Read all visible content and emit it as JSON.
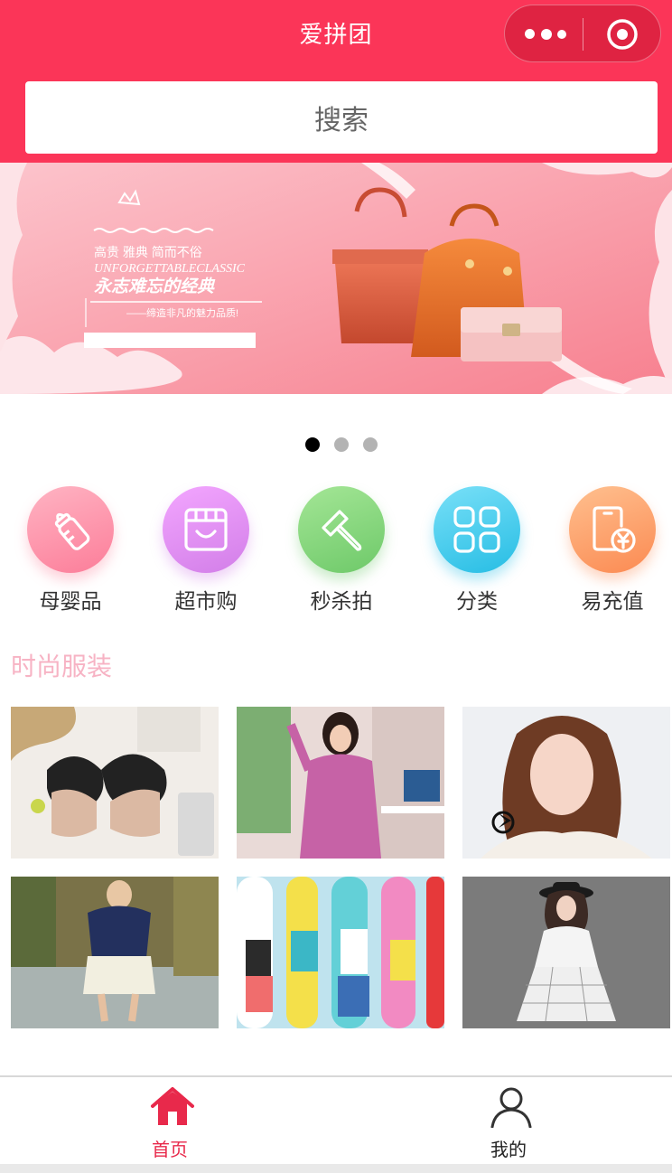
{
  "header": {
    "title": "爱拼团",
    "accent": "#fb3558"
  },
  "search": {
    "label": "搜索"
  },
  "banner": {
    "lines": [
      "高贵 雅典 简而不俗",
      "UNFORGETTABLECLASSIC",
      "永志难忘的经典",
      "——缔造非凡的魅力品质!"
    ],
    "current_slide": 1,
    "slide_count": 3
  },
  "categories": [
    {
      "label": "母婴品",
      "icon": "baby-bottle-icon",
      "color": "#fd8fa5"
    },
    {
      "label": "超市购",
      "icon": "store-icon",
      "color": "#e48bf0"
    },
    {
      "label": "秒杀拍",
      "icon": "hammer-icon",
      "color": "#7ed27a"
    },
    {
      "label": "分类",
      "icon": "grid-icon",
      "color": "#42c8ea"
    },
    {
      "label": "易充值",
      "icon": "phone-recharge-icon",
      "color": "#fda06a"
    }
  ],
  "section": {
    "title": "时尚服装"
  },
  "tabbar": {
    "home_label": "首页",
    "mine_label": "我的",
    "active_color": "#e8294b"
  }
}
